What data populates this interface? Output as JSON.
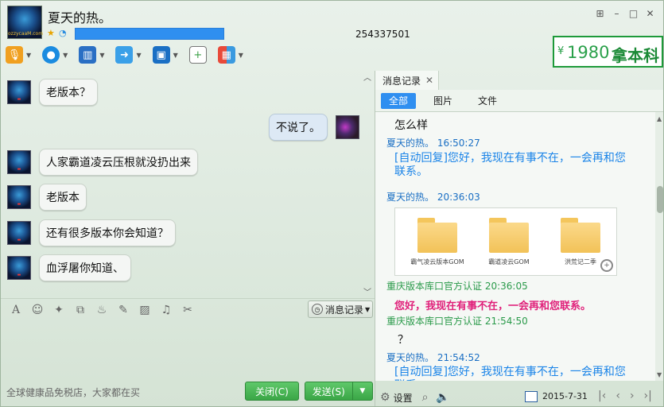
{
  "header": {
    "contact_name": "夏天的热。",
    "qq_number": "254337501",
    "avatar_label": "ozzycaaM.com",
    "window_controls": [
      "⊞",
      "–",
      "□",
      "✕"
    ]
  },
  "ad": {
    "yen": "¥",
    "amount": "1980",
    "text": "拿本科"
  },
  "toolbar": {
    "items": [
      "voice",
      "video",
      "screen-share",
      "file-transfer",
      "remote-desktop",
      "invite",
      "apps"
    ]
  },
  "chat": {
    "messages": [
      {
        "side": "left",
        "text": "老版本？"
      },
      {
        "side": "right",
        "text": "不说了。"
      },
      {
        "side": "left",
        "text": "人家霸道凌云压根就没扔出来"
      },
      {
        "side": "left",
        "text": "老版本"
      },
      {
        "side": "left",
        "text": "还有很多版本你会知道？"
      },
      {
        "side": "left",
        "text": "血浮屠你知道、"
      }
    ]
  },
  "input_toolbar": {
    "history_label": "消息记录"
  },
  "bottom": {
    "ad_text": "全球健康品免税店，大家都在买",
    "close_label": "关闭(C)",
    "send_label": "发送(S)"
  },
  "panel": {
    "tab_title": "消息记录",
    "filters": [
      "全部",
      "图片",
      "文件"
    ],
    "history": [
      {
        "kind": "text",
        "text": "怎么样"
      },
      {
        "kind": "meta-blue",
        "text": "夏天的热。 16:50:27"
      },
      {
        "kind": "auto",
        "text": "[自动回复]您好，我现在有事不在，一会再和您联系。"
      },
      {
        "kind": "meta-blue",
        "text": "夏天的热。 20:36:03"
      },
      {
        "kind": "meta-green",
        "text": "重庆版本库口官方认证 20:36:05"
      },
      {
        "kind": "pink",
        "text": "您好，我现在有事不在，一会再和您联系。"
      },
      {
        "kind": "meta-green",
        "text": "重庆版本库口官方认证 21:54:50"
      },
      {
        "kind": "text",
        "text": "？"
      },
      {
        "kind": "meta-blue",
        "text": "夏天的热。 21:54:52"
      },
      {
        "kind": "auto",
        "text": "[自动回复]您好，我现在有事不在，一会再和您联系。"
      }
    ],
    "folders": [
      "霸气凌云版本GOM",
      "霸道凌云GOM",
      "洪荒记二季"
    ],
    "settings_label": "设置",
    "date": "2015-7-31"
  }
}
